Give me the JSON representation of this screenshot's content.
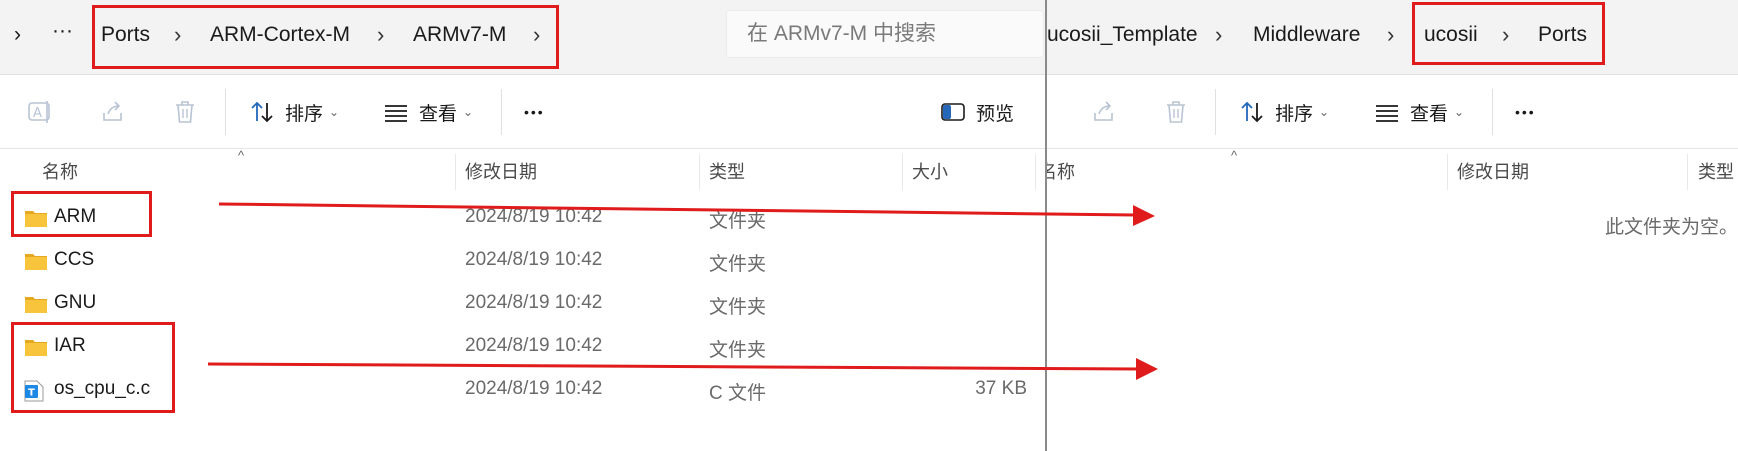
{
  "left_window": {
    "breadcrumb": {
      "expand_glyph": "›",
      "overflow_glyph": "···",
      "items": [
        "Ports",
        "ARM-Cortex-M",
        "ARMv7-M"
      ],
      "separator": "›"
    },
    "search": {
      "placeholder": "在 ARMv7-M 中搜索"
    },
    "toolbar": {
      "sort_label": "排序",
      "view_label": "查看",
      "more_glyph": "•••",
      "preview_label": "预览"
    },
    "columns": {
      "name": "名称",
      "date": "修改日期",
      "type": "类型",
      "size": "大小"
    },
    "files": [
      {
        "name": "ARM",
        "date": "2024/8/19 10:42",
        "type": "文件夹",
        "size": "",
        "icon": "folder-icon"
      },
      {
        "name": "CCS",
        "date": "2024/8/19 10:42",
        "type": "文件夹",
        "size": "",
        "icon": "folder-icon"
      },
      {
        "name": "GNU",
        "date": "2024/8/19 10:42",
        "type": "文件夹",
        "size": "",
        "icon": "folder-icon"
      },
      {
        "name": "IAR",
        "date": "2024/8/19 10:42",
        "type": "文件夹",
        "size": "",
        "icon": "folder-icon"
      },
      {
        "name": "os_cpu_c.c",
        "date": "2024/8/19 10:42",
        "type": "C 文件",
        "size": "37 KB",
        "icon": "c-file-icon"
      }
    ]
  },
  "right_window": {
    "breadcrumb": {
      "items": [
        "ucosii_Template",
        "Middleware",
        "ucosii",
        "Ports"
      ],
      "separator": "›"
    },
    "toolbar": {
      "sort_label": "排序",
      "view_label": "查看",
      "more_glyph": "•••"
    },
    "columns": {
      "name": "名称",
      "date": "修改日期",
      "type": "类型"
    },
    "empty_message": "此文件夹为空。"
  },
  "colors": {
    "annotation_red": "#e01b1b",
    "folder_yellow": "#f8c43b",
    "folder_dark": "#e5a921",
    "c_file_blue": "#1e88e5",
    "accent_blue": "#2567b8"
  }
}
